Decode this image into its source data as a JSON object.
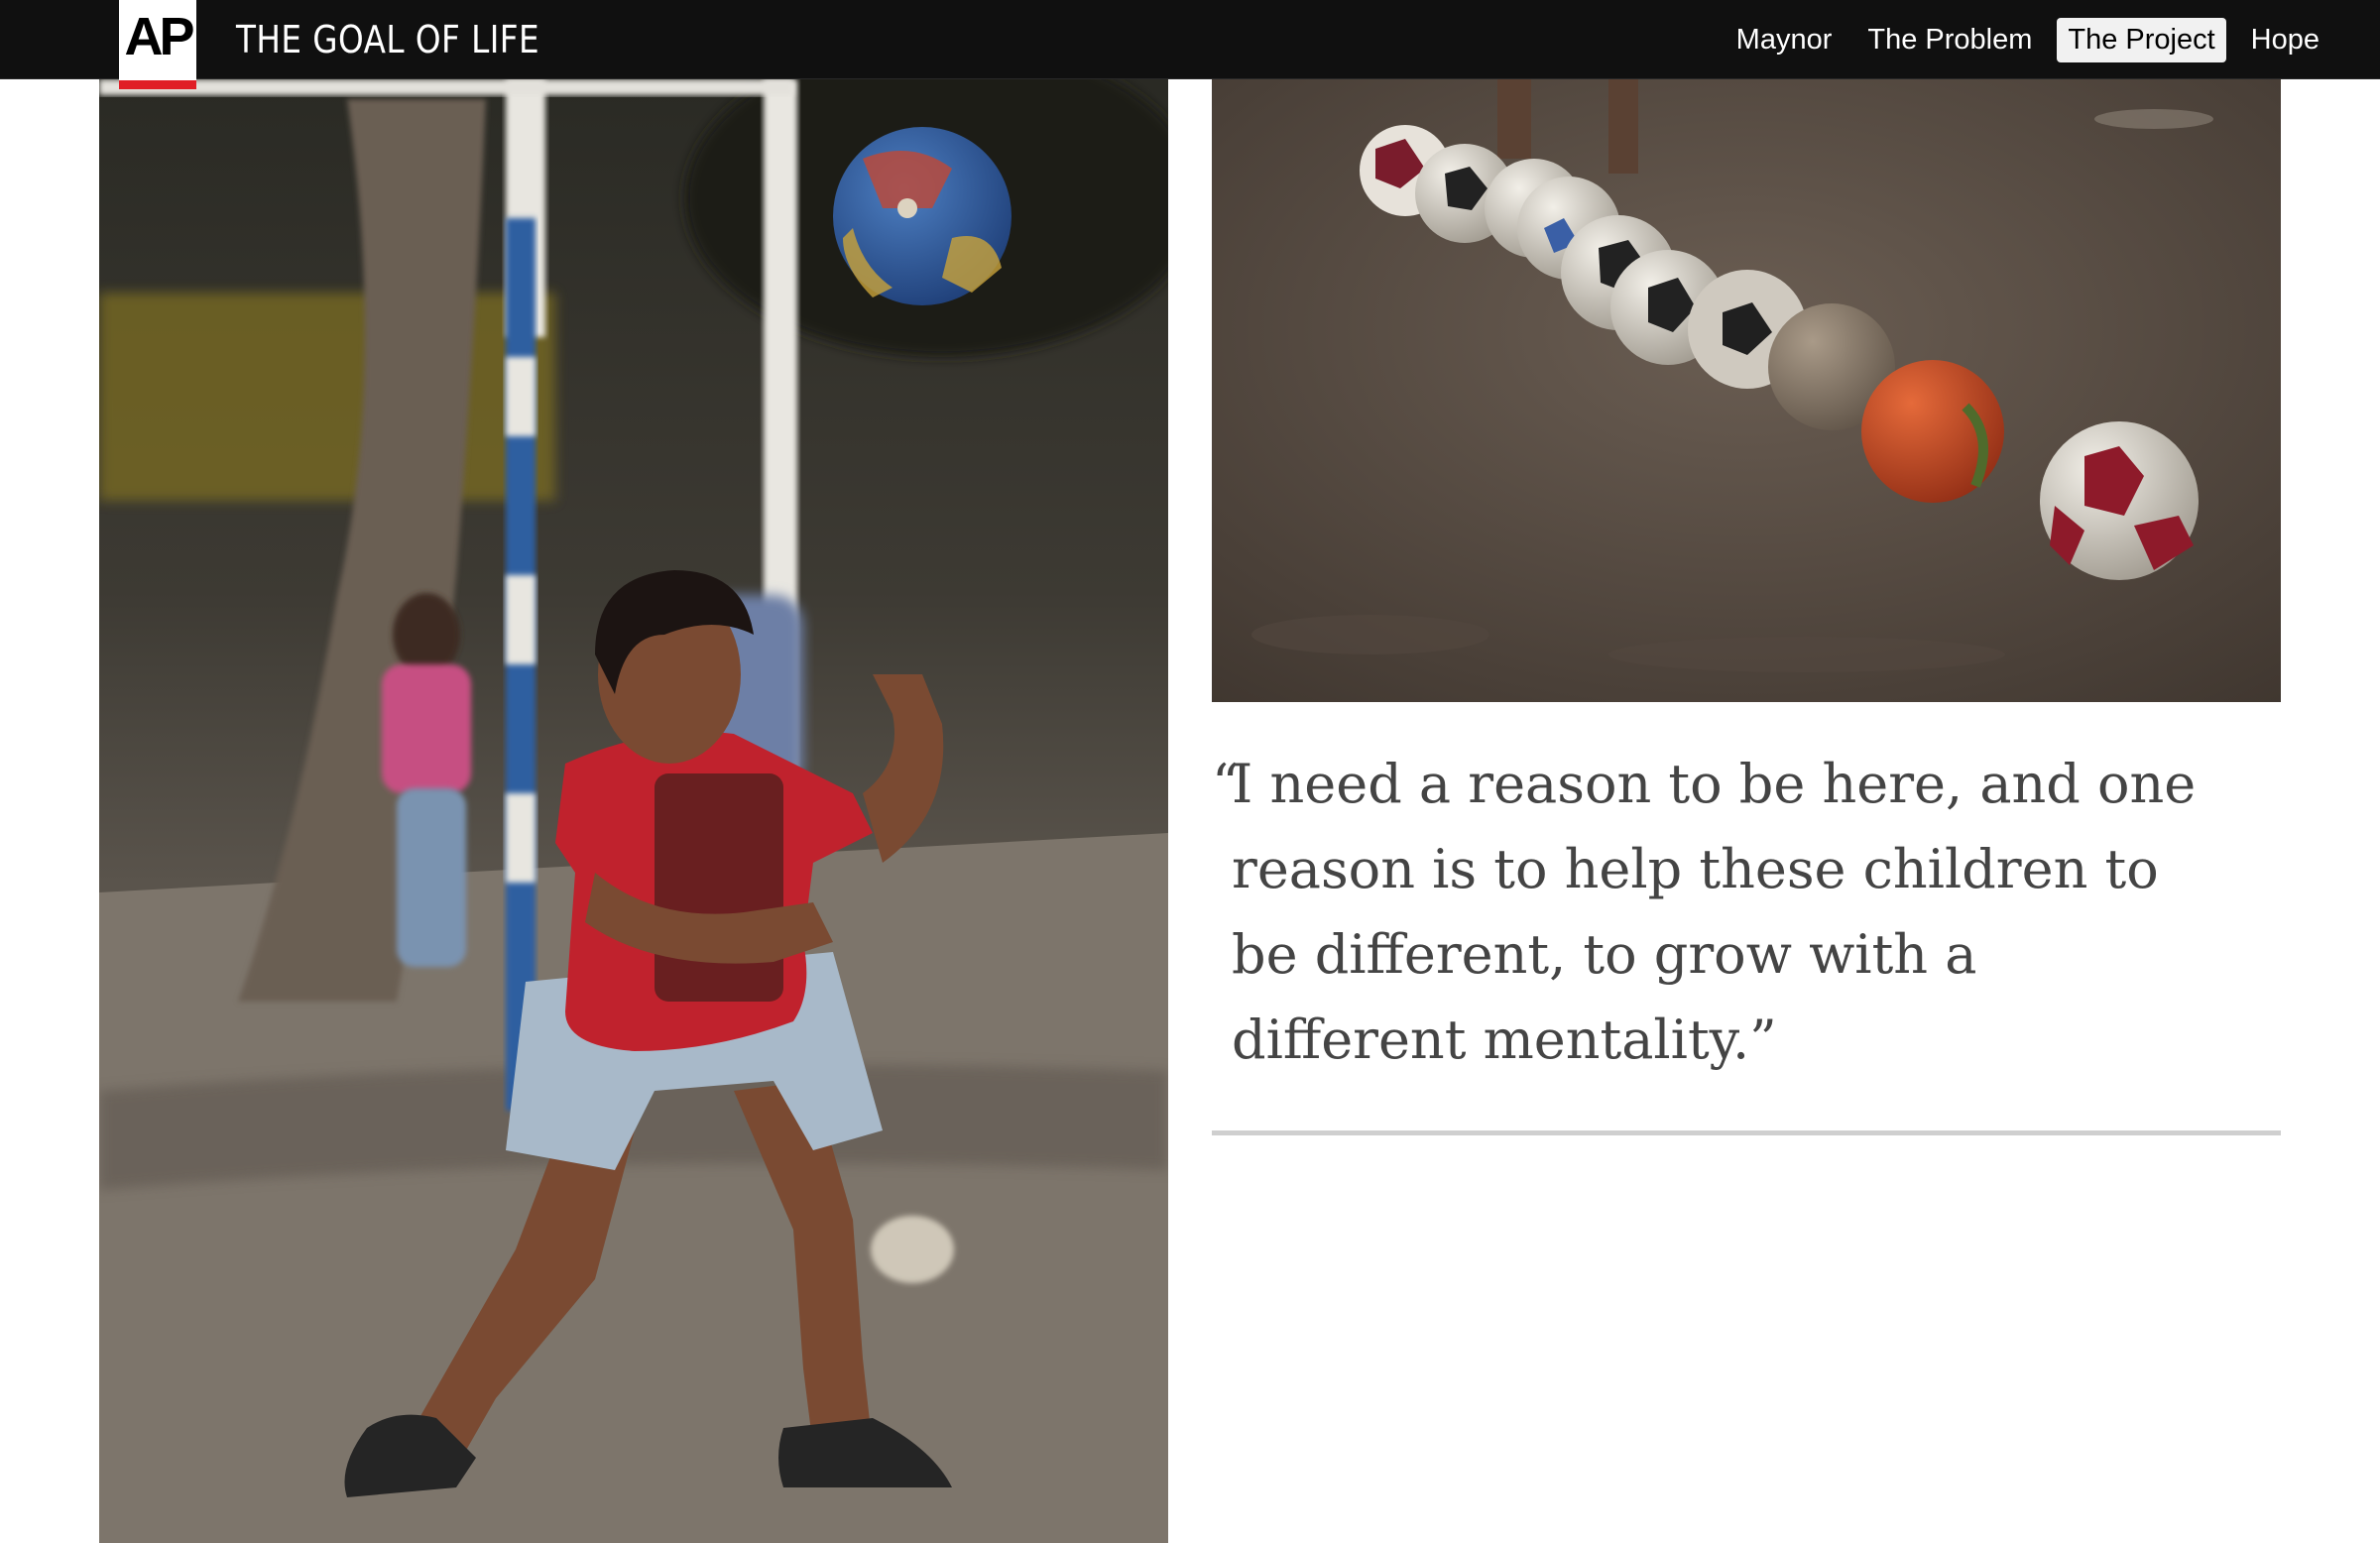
{
  "header": {
    "logo_text": "AP",
    "site_title": "THE GOAL OF LIFE",
    "nav": [
      {
        "label": "Maynor",
        "active": false
      },
      {
        "label": "The Problem",
        "active": false
      },
      {
        "label": "The Project",
        "active": true
      },
      {
        "label": "Hope",
        "active": false
      }
    ]
  },
  "quote": {
    "open_mark": "“",
    "text": "I need a reason to be here, and one reason is to help these children to be different, to grow with a different mentality.”"
  },
  "colors": {
    "topbar": "#101010",
    "brand_red": "#e01e26",
    "quote_text": "#444444",
    "rule": "#cfcfcf"
  }
}
